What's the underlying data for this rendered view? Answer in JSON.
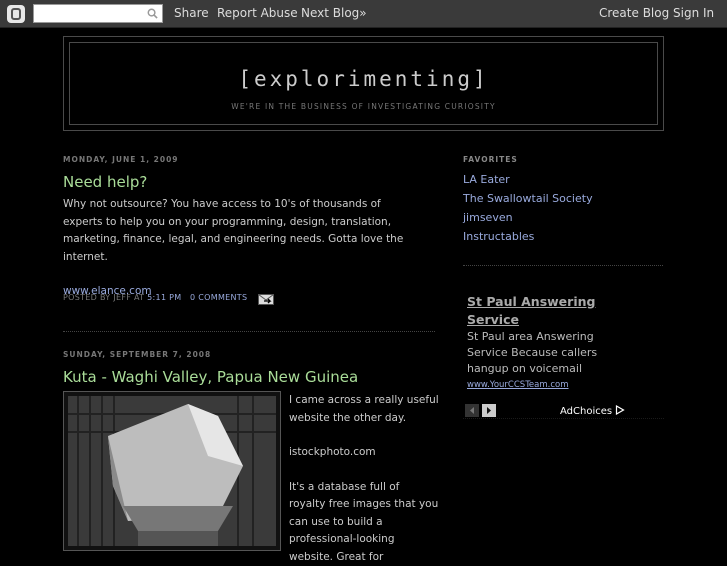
{
  "navbar": {
    "share": "Share",
    "report_abuse": "Report Abuse",
    "next_blog": "Next Blog»",
    "create_blog": "Create Blog",
    "sign_in": "Sign In",
    "search_placeholder": ""
  },
  "header": {
    "title": "[explorimenting]",
    "description": "WE'RE IN THE BUSINESS OF INVESTIGATING CURIOSITY"
  },
  "posts": [
    {
      "date": "MONDAY, JUNE 1, 2009",
      "title": "Need help?",
      "body": "Why not outsource? You have access to 10's of thousands of experts to help you on your programming, design, translation, marketing, finance, legal, and engineering needs. Gotta love the internet.",
      "link": "www.elance.com",
      "footer_posted_by": "POSTED BY JEFF AT",
      "footer_time": "5:11 PM",
      "footer_comments": "0 COMMENTS"
    },
    {
      "date": "SUNDAY, SEPTEMBER 7, 2008",
      "title": "Kuta - Waghi Valley, Papua New Guinea",
      "text1": "I came across a really useful website the other day.",
      "link": "istockphoto.com",
      "text2": "It's a database full of royalty free images that you can use to build a professional-looking website. Great for"
    }
  ],
  "sidebar": {
    "heading": "FAVORITES",
    "links": [
      "LA Eater",
      "The Swallowtail Society",
      "jimseven",
      "Instructables"
    ]
  },
  "ad": {
    "title": "St Paul Answering Service",
    "text": "St Paul area Answering Service Because callers hangup on voicemail",
    "url": "www.YourCCSTeam.com",
    "adchoices": "AdChoices"
  },
  "colors": {
    "background": "#000000",
    "post_title": "#aadd99",
    "link": "#99aadd"
  }
}
